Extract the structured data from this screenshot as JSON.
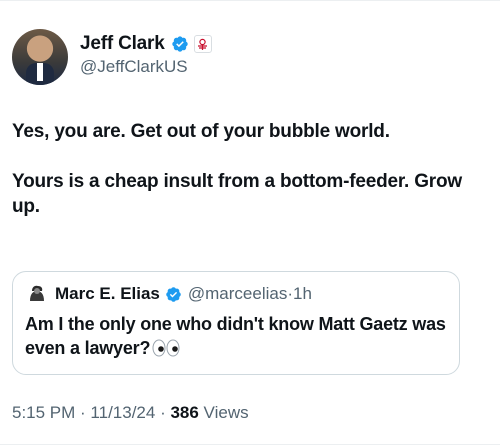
{
  "author": {
    "display_name": "Jeff Clark",
    "handle": "@JeffClarkUS"
  },
  "tweet": {
    "paragraphs": [
      "Yes, you are. Get out of your bubble world.",
      "Yours is a cheap insult from a bottom-feeder. Grow up."
    ]
  },
  "quoted": {
    "display_name": "Marc E. Elias",
    "handle": "@marceelias",
    "separator": "·",
    "time": "1h",
    "text": "Am I the only one who didn't know Matt Gaetz was even a lawyer?"
  },
  "meta": {
    "time": "5:15 PM",
    "sep1": " · ",
    "date": "11/13/24",
    "sep2": " · ",
    "views_count": "386",
    "views_label": " Views"
  },
  "colors": {
    "verified_blue": "#1d9bf0",
    "secondary_text": "#536471",
    "primary_text": "#0f1419",
    "affiliation_red": "#c8102e"
  },
  "icons": [
    "verified-badge-icon",
    "affiliation-seal-icon",
    "eyes-emoji-icon"
  ]
}
